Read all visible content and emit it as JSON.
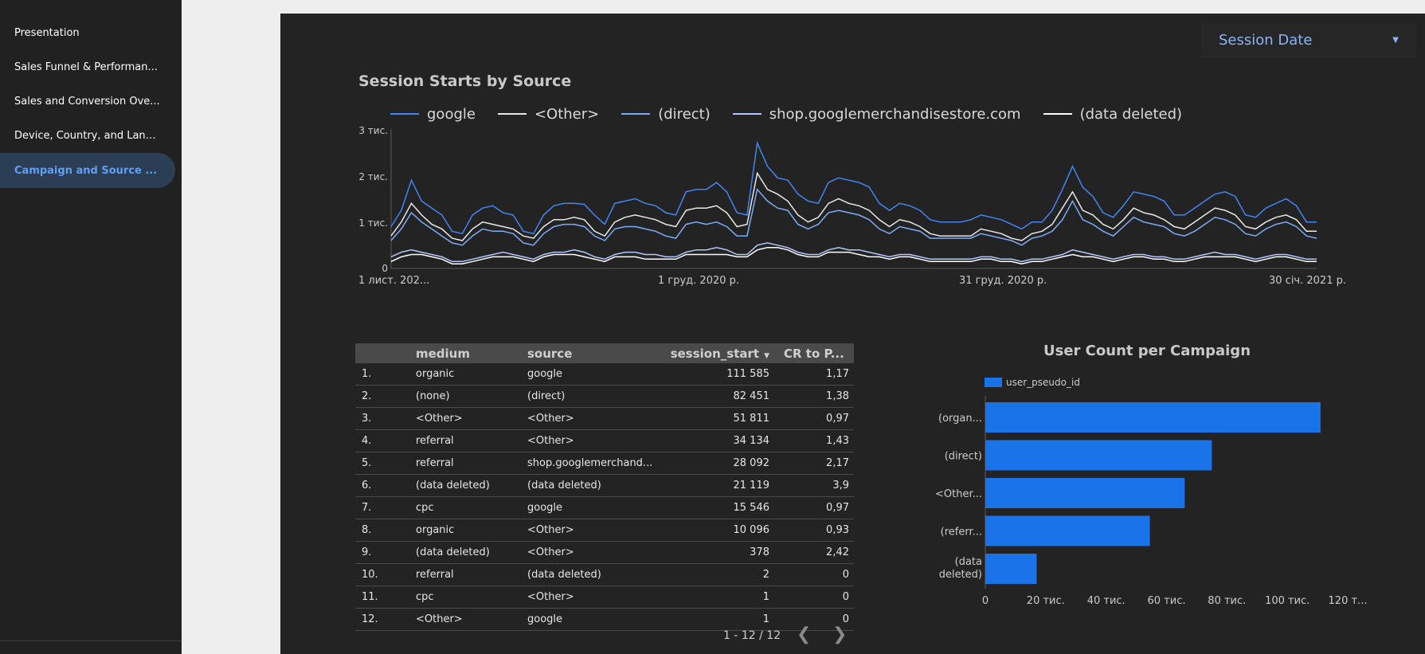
{
  "sidebar": {
    "items": [
      {
        "label": "Presentation"
      },
      {
        "label": "Sales Funnel & Performan..."
      },
      {
        "label": "Sales and Conversion Ove..."
      },
      {
        "label": "Device, Country, and Land..."
      },
      {
        "label": "Campaign and Source ..."
      }
    ],
    "active_index": 4
  },
  "date_control": {
    "label": "Session Date"
  },
  "line_chart": {
    "title": "Session Starts by Source",
    "legend": [
      "google",
      "<Other>",
      "(direct)",
      "shop.googlemerchandisestore.com",
      "(data deleted)"
    ],
    "y_ticks": [
      "0",
      "1 тис.",
      "2 тис.",
      "3 тис."
    ],
    "x_ticks": [
      "1 лист. 202...",
      "1 груд. 2020 р.",
      "31 груд. 2020 р.",
      "30 січ. 2021 р."
    ]
  },
  "table": {
    "headers": [
      "",
      "medium",
      "source",
      "session_start",
      "CR to P..."
    ],
    "rows": [
      [
        "1.",
        "organic",
        "google",
        "111 585",
        "1,17"
      ],
      [
        "2.",
        "(none)",
        "(direct)",
        "82 451",
        "1,38"
      ],
      [
        "3.",
        "<Other>",
        "<Other>",
        "51 811",
        "0,97"
      ],
      [
        "4.",
        "referral",
        "<Other>",
        "34 134",
        "1,43"
      ],
      [
        "5.",
        "referral",
        "shop.googlemerchand...",
        "28 092",
        "2,17"
      ],
      [
        "6.",
        "(data deleted)",
        "(data deleted)",
        "21 119",
        "3,9"
      ],
      [
        "7.",
        "cpc",
        "google",
        "15 546",
        "0,97"
      ],
      [
        "8.",
        "organic",
        "<Other>",
        "10 096",
        "0,93"
      ],
      [
        "9.",
        "(data deleted)",
        "<Other>",
        "378",
        "2,42"
      ],
      [
        "10.",
        "referral",
        "(data deleted)",
        "2",
        "0"
      ],
      [
        "11.",
        "cpc",
        "<Other>",
        "1",
        "0"
      ],
      [
        "12.",
        "<Other>",
        "google",
        "1",
        "0"
      ]
    ],
    "pagination": "1 - 12 / 12"
  },
  "bar_chart": {
    "title": "User Count per Campaign",
    "legend": "user_pseudo_id",
    "x_ticks": [
      "0",
      "20 тис.",
      "40 тис.",
      "60 тис.",
      "80 тис.",
      "100 тис.",
      "120 т..."
    ]
  },
  "colors": {
    "google": "#4285f4",
    "other": "#e8e8e8",
    "direct": "#7cacf8",
    "shop": "#b4c8ff",
    "data_deleted": "#ffffff",
    "bar": "#1a73e8"
  },
  "chart_data": [
    {
      "type": "line",
      "title": "Session Starts by Source",
      "x": {
        "start": "2020-11-01",
        "end": "2021-01-31",
        "points": 92
      },
      "ylim": [
        0,
        3000
      ],
      "grid": false,
      "legend_position": "top",
      "series": [
        {
          "name": "google",
          "values": [
            900,
            1250,
            1900,
            1450,
            1300,
            1150,
            800,
            750,
            1150,
            1300,
            1350,
            1200,
            1150,
            800,
            750,
            1150,
            1350,
            1400,
            1400,
            1380,
            1150,
            950,
            1400,
            1450,
            1500,
            1400,
            1350,
            1200,
            1150,
            1650,
            1700,
            1700,
            1850,
            1650,
            1200,
            1150,
            2700,
            2200,
            1950,
            1900,
            1600,
            1450,
            1400,
            1850,
            1950,
            1900,
            1850,
            1750,
            1400,
            1250,
            1400,
            1350,
            1250,
            1050,
            1000,
            1000,
            1000,
            1050,
            1150,
            1100,
            1050,
            950,
            850,
            1000,
            1000,
            1250,
            1700,
            2200,
            1750,
            1550,
            1200,
            1100,
            1350,
            1650,
            1600,
            1550,
            1450,
            1150,
            1150,
            1300,
            1450,
            1600,
            1650,
            1550,
            1150,
            1100,
            1300,
            1400,
            1500,
            1350,
            1000,
            1000
          ]
        },
        {
          "name": "<Other>",
          "values": [
            700,
            1000,
            1400,
            1150,
            950,
            850,
            650,
            600,
            850,
            1000,
            950,
            900,
            850,
            700,
            650,
            900,
            1050,
            1050,
            1100,
            1050,
            800,
            700,
            1000,
            1100,
            1150,
            1100,
            1050,
            950,
            900,
            1250,
            1300,
            1300,
            1350,
            1200,
            900,
            950,
            2050,
            1700,
            1600,
            1450,
            1150,
            1000,
            1100,
            1400,
            1500,
            1400,
            1350,
            1250,
            1050,
            900,
            1050,
            1000,
            900,
            750,
            700,
            700,
            700,
            700,
            850,
            800,
            750,
            650,
            600,
            750,
            800,
            950,
            1300,
            1650,
            1250,
            1150,
            950,
            850,
            1050,
            1300,
            1200,
            1150,
            1050,
            900,
            850,
            1000,
            1150,
            1300,
            1250,
            1150,
            900,
            850,
            1000,
            1100,
            1150,
            1050,
            800,
            800
          ]
        },
        {
          "name": "(direct)",
          "values": [
            600,
            850,
            1200,
            1000,
            850,
            700,
            550,
            500,
            700,
            850,
            800,
            800,
            750,
            550,
            500,
            750,
            900,
            950,
            950,
            900,
            700,
            600,
            850,
            900,
            900,
            850,
            800,
            700,
            650,
            950,
            1000,
            950,
            1000,
            900,
            700,
            700,
            1700,
            1450,
            1300,
            1250,
            950,
            850,
            950,
            1200,
            1250,
            1200,
            1150,
            1050,
            850,
            750,
            900,
            850,
            800,
            650,
            650,
            650,
            650,
            650,
            750,
            700,
            650,
            600,
            500,
            650,
            700,
            800,
            1050,
            1450,
            1050,
            950,
            800,
            700,
            900,
            1100,
            1000,
            950,
            900,
            750,
            700,
            800,
            950,
            1100,
            1050,
            950,
            750,
            700,
            850,
            950,
            1000,
            900,
            700,
            650
          ]
        },
        {
          "name": "shop.googlemerchandisestore.com",
          "values": [
            250,
            350,
            400,
            350,
            300,
            250,
            150,
            150,
            200,
            250,
            300,
            350,
            300,
            250,
            200,
            300,
            350,
            350,
            400,
            350,
            250,
            200,
            300,
            350,
            350,
            300,
            300,
            250,
            250,
            350,
            400,
            400,
            450,
            400,
            300,
            300,
            500,
            550,
            500,
            450,
            350,
            300,
            300,
            400,
            450,
            400,
            400,
            350,
            300,
            250,
            300,
            300,
            250,
            200,
            200,
            200,
            200,
            200,
            250,
            250,
            200,
            200,
            150,
            200,
            200,
            250,
            300,
            400,
            350,
            300,
            250,
            200,
            250,
            300,
            300,
            250,
            250,
            200,
            200,
            250,
            300,
            350,
            300,
            300,
            250,
            200,
            250,
            300,
            300,
            250,
            200,
            200
          ]
        },
        {
          "name": "(data deleted)",
          "values": [
            150,
            250,
            300,
            300,
            250,
            200,
            100,
            100,
            150,
            200,
            250,
            250,
            250,
            200,
            150,
            250,
            300,
            300,
            300,
            250,
            200,
            150,
            250,
            250,
            250,
            200,
            200,
            200,
            200,
            300,
            300,
            300,
            300,
            300,
            250,
            250,
            400,
            450,
            450,
            400,
            300,
            250,
            250,
            350,
            350,
            350,
            300,
            250,
            250,
            200,
            250,
            250,
            200,
            150,
            150,
            150,
            150,
            150,
            200,
            200,
            150,
            150,
            100,
            150,
            150,
            200,
            250,
            300,
            250,
            250,
            200,
            150,
            200,
            250,
            250,
            200,
            200,
            150,
            150,
            200,
            250,
            250,
            250,
            250,
            200,
            150,
            200,
            250,
            250,
            200,
            150,
            150
          ]
        }
      ]
    },
    {
      "type": "bar",
      "orientation": "horizontal",
      "title": "User Count per Campaign",
      "categories": [
        "(organ...",
        "(direct)",
        "<Other...",
        "(referr...",
        "(data deleted)"
      ],
      "series": [
        {
          "name": "user_pseudo_id",
          "values": [
            111000,
            75000,
            66000,
            54500,
            17000
          ]
        }
      ],
      "xlim": [
        0,
        120000
      ],
      "legend_position": "top-left"
    }
  ]
}
